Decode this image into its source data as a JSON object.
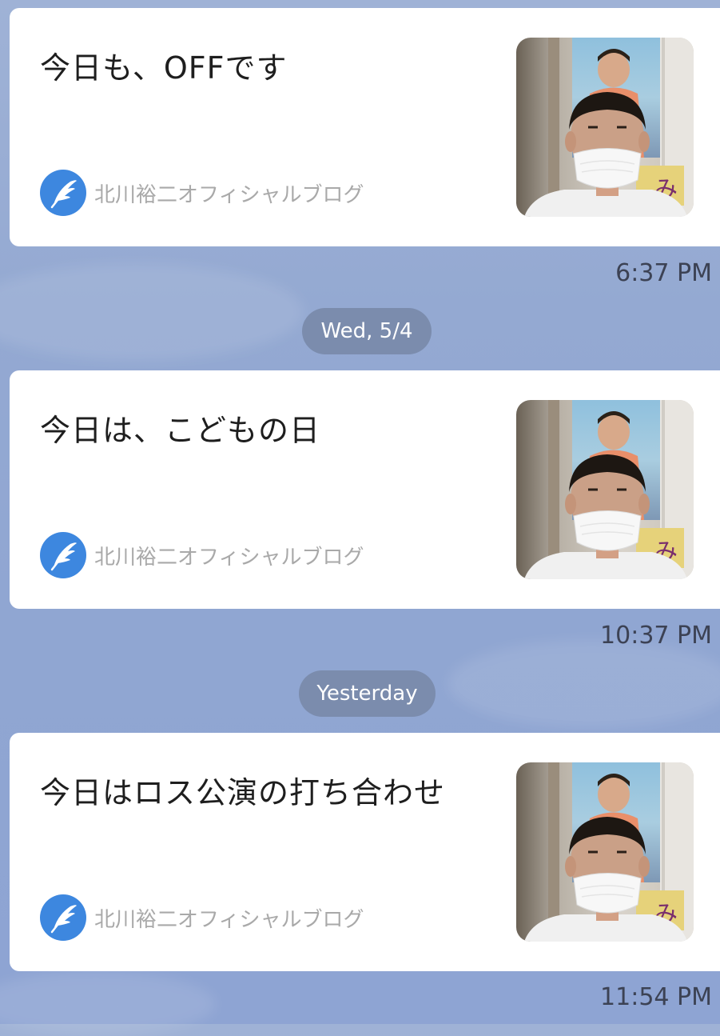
{
  "messages": [
    {
      "title": "今日も、OFFです",
      "source": "北川裕二オフィシャルブログ",
      "time": "6:37 PM"
    },
    {
      "title": "今日は、こどもの日",
      "source": "北川裕二オフィシャルブログ",
      "time": "10:37 PM"
    },
    {
      "title": "今日はロス公演の打ち合わせ",
      "source": "北川裕二オフィシャルブログ",
      "time": "11:54 PM"
    }
  ],
  "date_separators": [
    "Wed, 5/4",
    "Yesterday"
  ],
  "colors": {
    "chat_background": "#94a9d2",
    "card_background": "#ffffff",
    "source_logo_blue": "#3d87df",
    "date_pill": "#7b8cad"
  },
  "icons": {
    "source_logo": "feather-pen-icon",
    "thumbnail": "masked-man-photo"
  }
}
